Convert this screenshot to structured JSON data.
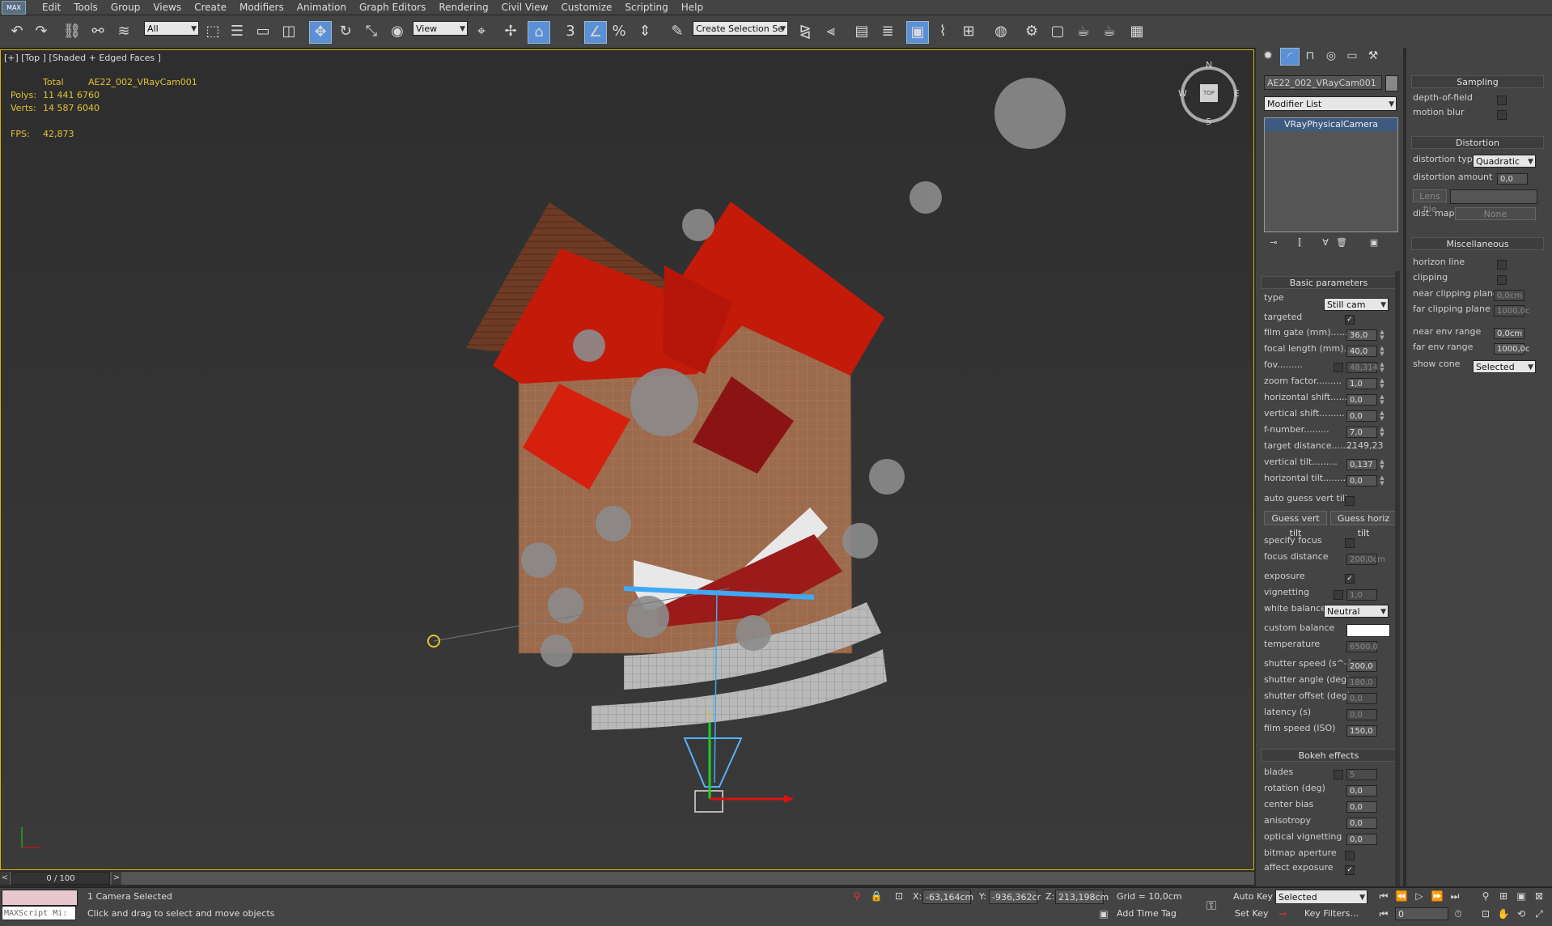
{
  "app": {
    "logo_text": "MAX"
  },
  "menu": [
    "Edit",
    "Tools",
    "Group",
    "Views",
    "Create",
    "Modifiers",
    "Animation",
    "Graph Editors",
    "Rendering",
    "Civil View",
    "Customize",
    "Scripting",
    "Help"
  ],
  "toolbar": {
    "filter_value": "All",
    "reference_coord": "View",
    "named_selection_placeholder": "Create Selection Se",
    "snap_label": "3"
  },
  "viewport": {
    "label": "[+] [Top ] [Shaded + Edged Faces ]",
    "stats": {
      "total_label": "Total",
      "object_name": "AE22_002_VRayCam001",
      "polys_label": "Polys:",
      "polys_value": "11 441 6760",
      "verts_label": "Verts:",
      "verts_value": "14 587 6040",
      "fps_label": "FPS:",
      "fps_value": "42,873"
    },
    "viewcube": {
      "n": "N",
      "s": "S",
      "w": "W",
      "e": "E",
      "top": "TOP"
    },
    "axis": {
      "y": "y",
      "x": "x"
    }
  },
  "command_panel": {
    "object_name": "AE22_002_VRayCam001",
    "modifier_list": "Modifier List",
    "stack_item": "VRayPhysicalCamera",
    "basic_parameters": {
      "header": "Basic parameters",
      "type_label": "type",
      "type_value": "Still cam",
      "targeted_label": "targeted",
      "targeted_checked": true,
      "fields": [
        {
          "label": "film gate (mm)",
          "value": "36,0",
          "checkbox": false,
          "dim": false
        },
        {
          "label": "focal length (mm)",
          "value": "40,0",
          "checkbox": false,
          "dim": false
        },
        {
          "label": "fov",
          "value": "48,314",
          "checkbox": true,
          "dim": true
        },
        {
          "label": "zoom factor",
          "value": "1,0",
          "checkbox": false,
          "dim": false
        },
        {
          "label": "horizontal shift",
          "value": "0,0",
          "checkbox": false,
          "dim": false
        },
        {
          "label": "vertical shift",
          "value": "0,0",
          "checkbox": false,
          "dim": false
        },
        {
          "label": "f-number",
          "value": "7,0",
          "checkbox": false,
          "dim": false
        },
        {
          "label": "target distance",
          "value": "2149,23",
          "checkbox": false,
          "dim": false,
          "plain": true
        },
        {
          "label": "vertical tilt",
          "value": "0,137",
          "checkbox": false,
          "dim": false
        },
        {
          "label": "horizontal tilt",
          "value": "0,0",
          "checkbox": false,
          "dim": false
        }
      ],
      "auto_guess_label": "auto guess vert tilt",
      "guess_vert_btn": "Guess vert tilt",
      "guess_horiz_btn": "Guess horiz tilt",
      "specify_focus_label": "specify focus",
      "focus_distance_label": "focus distance",
      "focus_distance_value": "200,0cm",
      "exposure_label": "exposure",
      "vignetting_label": "vignetting",
      "vignetting_value": "1,0",
      "white_balance_label": "white balance",
      "white_balance_value": "Neutral",
      "custom_balance_label": "custom balance",
      "temperature_label": "temperature",
      "temperature_value": "6500,0",
      "shutter_speed_label": "shutter speed (s^-1",
      "shutter_speed_value": "200,0",
      "shutter_angle_label": "shutter angle (deg)",
      "shutter_angle_value": "180,0",
      "shutter_offset_label": "shutter offset (deg)",
      "shutter_offset_value": "0,0",
      "latency_label": "latency (s)",
      "latency_value": "0,0",
      "film_speed_label": "film speed (ISO)",
      "film_speed_value": "150,0"
    },
    "bokeh": {
      "header": "Bokeh effects",
      "blades_label": "blades",
      "blades_value": "5",
      "rotation_label": "rotation (deg)",
      "rotation_value": "0,0",
      "center_bias_label": "center bias",
      "center_bias_value": "0,0",
      "anisotropy_label": "anisotropy",
      "anisotropy_value": "0,0",
      "optical_vignetting_label": "optical vignetting",
      "optical_vignetting_value": "0,0",
      "bitmap_aperture_label": "bitmap aperture",
      "affect_exposure_label": "affect exposure"
    }
  },
  "right_rollout": {
    "sampling": {
      "header": "Sampling",
      "dof_label": "depth-of-field",
      "motion_blur_label": "motion blur"
    },
    "distortion": {
      "header": "Distortion",
      "type_label": "distortion type",
      "type_value": "Quadratic",
      "amount_label": "distortion amount",
      "amount_value": "0,0",
      "lens_file_label": "Lens file",
      "dist_map_label": "dist. map",
      "dist_map_value": "None"
    },
    "misc": {
      "header": "Miscellaneous",
      "horizon_label": "horizon line",
      "clipping_label": "clipping",
      "near_clip_label": "near clipping plane",
      "near_clip_value": "0,0cm",
      "far_clip_label": "far clipping plane",
      "far_clip_value": "1000,0c",
      "near_env_label": "near env range",
      "near_env_value": "0,0cm",
      "far_env_label": "far env range",
      "far_env_value": "1000,0c",
      "show_cone_label": "show cone",
      "show_cone_value": "Selected"
    }
  },
  "timeline": {
    "frame": "0 / 100"
  },
  "status": {
    "script_label": "MAXScript Mi:",
    "selected_text": "1 Camera Selected",
    "prompt_text": "Click and drag to select and move objects",
    "x_label": "X:",
    "x_value": "-63,164cm",
    "y_label": "Y:",
    "y_value": "-936,362cr",
    "z_label": "Z:",
    "z_value": "213,198cm",
    "grid": "Grid = 10,0cm",
    "add_time_tag": "Add Time Tag",
    "auto_key": "Auto Key",
    "set_key": "Set Key",
    "selected_dd": "Selected",
    "key_filters": "Key Filters...",
    "frame_value": "0"
  },
  "colors": {
    "roof_red": "#c41a0a",
    "dark_red": "#8a1414",
    "terrain": "#9c6a4c",
    "accent_blue": "#5b8fd6",
    "viewport_border": "#d9b200",
    "stats_yellow": "#e2c232"
  }
}
